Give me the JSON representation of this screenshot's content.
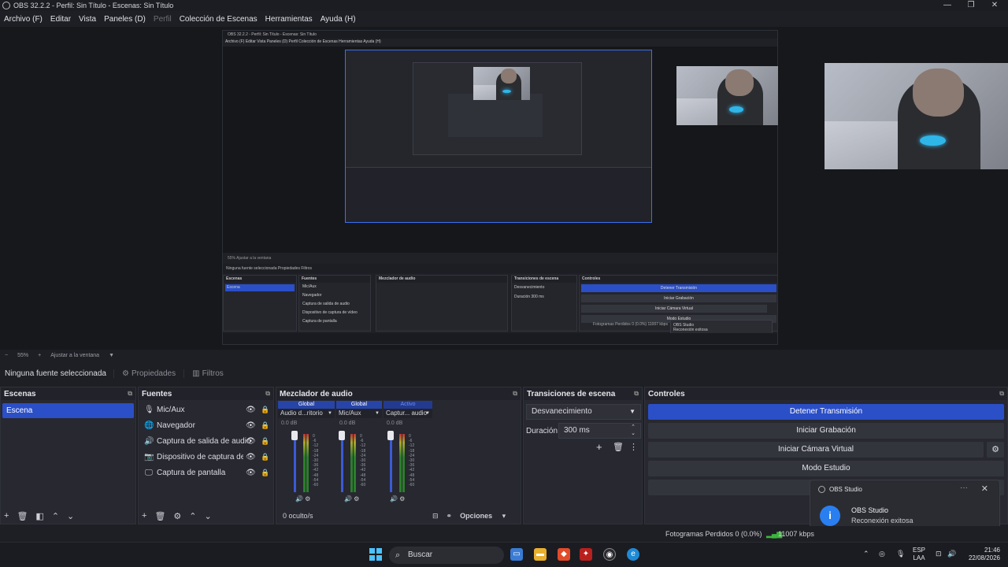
{
  "window": {
    "title": "OBS 32.2.2 - Perfil: Sin Título - Escenas: Sin Título",
    "minimize": "—",
    "maximize": "❐",
    "close": "✕"
  },
  "menu": {
    "items": [
      "Archivo (F)",
      "Editar",
      "Vista",
      "Paneles (D)",
      "Perfil",
      "Colección de Escenas",
      "Herramientas",
      "Ayuda (H)"
    ]
  },
  "zoom": {
    "minus": "−",
    "percent": "55%",
    "plus": "+",
    "fit_label": "Ajustar a la ventana",
    "caret": "▼"
  },
  "source_toolbar": {
    "no_selection": "Ninguna fuente seleccionada",
    "properties": "Propiedades",
    "filters": "Filtros"
  },
  "scenes": {
    "title": "Escenas",
    "items": [
      "Escena"
    ]
  },
  "sources": {
    "title": "Fuentes",
    "items": [
      {
        "label": "Mic/Aux",
        "icon": "microphone-icon"
      },
      {
        "label": "Navegador",
        "icon": "globe-icon"
      },
      {
        "label": "Captura de salida de audio",
        "icon": "speaker-icon"
      },
      {
        "label": "Dispositivo de captura de vídeo",
        "icon": "camera-icon"
      },
      {
        "label": "Captura de pantalla",
        "icon": "monitor-icon"
      }
    ]
  },
  "mixer": {
    "title": "Mezclador de audio",
    "channels": [
      {
        "tag": "Global",
        "name": "Audio d...ritorio",
        "db": "0.0 dB"
      },
      {
        "tag": "Global",
        "name": "Mic/Aux",
        "db": "0.0 dB"
      },
      {
        "tag": "Activo",
        "name": "Captur... audio",
        "db": "0.0 dB"
      }
    ],
    "scale": [
      "0",
      "-6",
      "-12",
      "-18",
      "-24",
      "-30",
      "-36",
      "-42",
      "-48",
      "-54",
      "-60"
    ],
    "footer_hidden": "0 oculto/s",
    "options": "Opciones"
  },
  "transitions": {
    "title": "Transiciones de escena",
    "selected": "Desvanecimiento",
    "duration_label": "Duración",
    "duration_value": "300 ms"
  },
  "controls": {
    "title": "Controles",
    "stop_stream": "Detener Transmisión",
    "start_recording": "Iniciar Grabación",
    "virtual_camera": "Iniciar Cámara Virtual",
    "studio_mode": "Modo Estudio"
  },
  "toast": {
    "app": "OBS Studio",
    "title": "OBS Studio",
    "message": "Reconexión exitosa"
  },
  "status": {
    "dropped_frames": "Fotogramas Perdidos 0 (0.0%)",
    "bitrate": "11007 kbps"
  },
  "taskbar": {
    "search": "Buscar",
    "lang_top": "ESP",
    "lang_bottom": "LAA",
    "time": "21:46",
    "date": "22/08/2026"
  },
  "nested": {
    "title": "OBS 32.2.2 - Perfil: Sin Título - Escenas: Sin Título",
    "menu": "Archivo (F)   Editar   Vista   Paneles (D)   Perfil   Colección de Escenas   Herramientas   Ayuda (H)",
    "zoom": "55%   Ajustar a la ventana",
    "no_selection": "Ninguna fuente seleccionada   Propiedades   Filtros",
    "panel_titles": [
      "Escenas",
      "Fuentes",
      "Mezclador de audio",
      "Transiciones de escena",
      "Controles"
    ],
    "scene": "Escena",
    "sources": [
      "Mic/Aux",
      "Navegador",
      "Captura de salida de audio",
      "Dispositivo de captura de vídeo",
      "Captura de pantalla"
    ],
    "transition": "Desvanecimiento",
    "duration": "Duración   300 ms",
    "buttons": [
      "Detener Transmisión",
      "Iniciar Grabación",
      "Iniciar Cámara Virtual",
      "Modo Estudio"
    ],
    "status": "Fotogramas Perdidos 0 (0.0%)   11007 kbps",
    "toast_title": "OBS Studio",
    "toast_msg": "Reconexión exitosa"
  }
}
